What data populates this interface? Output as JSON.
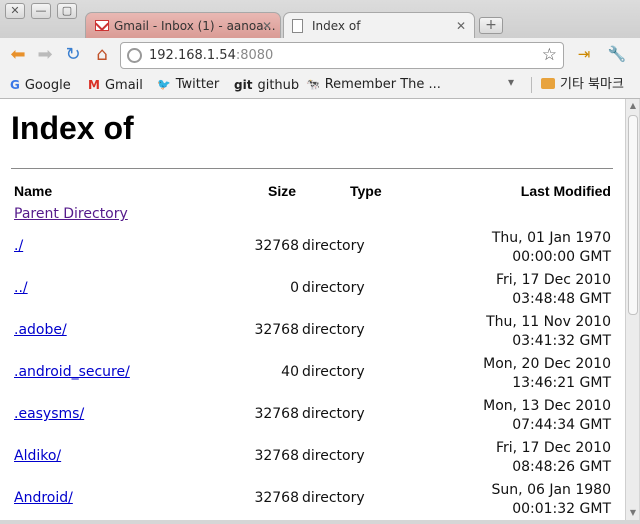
{
  "window": {
    "close_glyph": "✕",
    "minimize_glyph": "—",
    "maximize_glyph": "▢"
  },
  "tabs": [
    {
      "title": "Gmail - Inbox (1) - aanoa…",
      "close": "✕",
      "icon": "gmail-icon"
    },
    {
      "title": "Index of",
      "close": "✕",
      "icon": "page-icon"
    }
  ],
  "newtab_glyph": "+",
  "toolbar": {
    "back": "⬅",
    "forward": "➡",
    "reload": "↻",
    "home": "⌂",
    "url_host": "192.168.1.54",
    "url_port": ":8080",
    "star": "☆",
    "extension": "⇥",
    "wrench": "🔧"
  },
  "bookmarks": {
    "items": [
      {
        "icon_text": "G",
        "label": "Google"
      },
      {
        "icon_text": "M",
        "label": "Gmail"
      },
      {
        "icon_text": "🐦",
        "label": "Twitter"
      },
      {
        "icon_text": "git",
        "label": "github"
      },
      {
        "icon_text": "🐄",
        "label": "Remember The ..."
      }
    ],
    "chevron": "▾",
    "other_label": "기타 북마크"
  },
  "page": {
    "title": "Index of",
    "columns": {
      "name": "Name",
      "size": "Size",
      "type": "Type",
      "modified": "Last Modified"
    },
    "parent_label": "Parent Directory",
    "rows": [
      {
        "name": "./",
        "size": "32768",
        "type": "directory",
        "date": "Thu, 01 Jan 1970",
        "time": "00:00:00 GMT"
      },
      {
        "name": "../",
        "size": "0",
        "type": "directory",
        "date": "Fri, 17 Dec 2010",
        "time": "03:48:48 GMT"
      },
      {
        "name": ".adobe/",
        "size": "32768",
        "type": "directory",
        "date": "Thu, 11 Nov 2010",
        "time": "03:41:32 GMT"
      },
      {
        "name": ".android_secure/",
        "size": "40",
        "type": "directory",
        "date": "Mon, 20 Dec 2010",
        "time": "13:46:21 GMT"
      },
      {
        "name": ".easysms/",
        "size": "32768",
        "type": "directory",
        "date": "Mon, 13 Dec 2010",
        "time": "07:44:34 GMT"
      },
      {
        "name": "Aldiko/",
        "size": "32768",
        "type": "directory",
        "date": "Fri, 17 Dec 2010",
        "time": "08:48:26 GMT"
      },
      {
        "name": "Android/",
        "size": "32768",
        "type": "directory",
        "date": "Sun, 06 Jan 1980",
        "time": "00:01:32 GMT"
      }
    ]
  },
  "scrollbar": {
    "up": "▲",
    "down": "▼"
  }
}
